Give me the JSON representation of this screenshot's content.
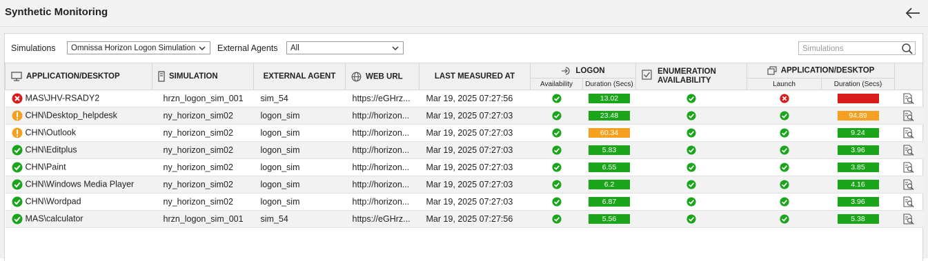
{
  "header": {
    "title": "Synthetic Monitoring",
    "back_icon": "back-arrow-icon"
  },
  "filters": {
    "simulations_label": "Simulations",
    "simulations_value": "Omnissa Horizon Logon Simulation",
    "agents_label": "External Agents",
    "agents_value": "All",
    "search_placeholder": "Simulations"
  },
  "table": {
    "headers": {
      "app": "APPLICATION/DESKTOP",
      "simulation": "SIMULATION",
      "agent": "EXTERNAL AGENT",
      "url": "WEB URL",
      "measured": "LAST MEASURED AT",
      "logon": "LOGON",
      "logon_avail": "Availability",
      "logon_dur": "Duration (Secs)",
      "enum_line1": "ENUMERATION",
      "enum_line2": "AVAILABILITY",
      "appdesk": "APPLICATION/DESKTOP",
      "launch": "Launch",
      "app_dur": "Duration (Secs)"
    },
    "colors": {
      "ok": "#1aa51a",
      "warn": "#f5a020",
      "error": "#d81c1c"
    },
    "rows": [
      {
        "status": "error",
        "app": "MAS\\JHV-RSADY2",
        "simulation": "hrzn_logon_sim_001",
        "agent": "sim_54",
        "url": "https://eGHrz...",
        "measured": "Mar 19, 2025 07:27:56",
        "logon_avail": "ok",
        "logon_dur": "13.02",
        "logon_color": "green",
        "enum_avail": "ok",
        "launch": "error",
        "app_dur": "",
        "app_color": "red"
      },
      {
        "status": "warn",
        "app": "CHN\\Desktop_helpdesk",
        "simulation": "ny_horizon_sim02",
        "agent": "logon_sim",
        "url": "http://horizon...",
        "measured": "Mar 19, 2025 07:27:03",
        "logon_avail": "ok",
        "logon_dur": "23.48",
        "logon_color": "green",
        "enum_avail": "ok",
        "launch": "ok",
        "app_dur": "94.89",
        "app_color": "orange"
      },
      {
        "status": "warn",
        "app": "CHN\\Outlook",
        "simulation": "ny_horizon_sim02",
        "agent": "logon_sim",
        "url": "http://horizon...",
        "measured": "Mar 19, 2025 07:27:03",
        "logon_avail": "ok",
        "logon_dur": "60.34",
        "logon_color": "orange",
        "enum_avail": "ok",
        "launch": "ok",
        "app_dur": "9.24",
        "app_color": "green"
      },
      {
        "status": "ok",
        "app": "CHN\\Editplus",
        "simulation": "ny_horizon_sim02",
        "agent": "logon_sim",
        "url": "http://horizon...",
        "measured": "Mar 19, 2025 07:27:03",
        "logon_avail": "ok",
        "logon_dur": "5.83",
        "logon_color": "green",
        "enum_avail": "ok",
        "launch": "ok",
        "app_dur": "3.96",
        "app_color": "green"
      },
      {
        "status": "ok",
        "app": "CHN\\Paint",
        "simulation": "ny_horizon_sim02",
        "agent": "logon_sim",
        "url": "http://horizon...",
        "measured": "Mar 19, 2025 07:27:03",
        "logon_avail": "ok",
        "logon_dur": "6.55",
        "logon_color": "green",
        "enum_avail": "ok",
        "launch": "ok",
        "app_dur": "3.85",
        "app_color": "green"
      },
      {
        "status": "ok",
        "app": "CHN\\Windows Media Player",
        "simulation": "ny_horizon_sim02",
        "agent": "logon_sim",
        "url": "http://horizon...",
        "measured": "Mar 19, 2025 07:27:03",
        "logon_avail": "ok",
        "logon_dur": "6.2",
        "logon_color": "green",
        "enum_avail": "ok",
        "launch": "ok",
        "app_dur": "4.16",
        "app_color": "green"
      },
      {
        "status": "ok",
        "app": "CHN\\Wordpad",
        "simulation": "ny_horizon_sim02",
        "agent": "logon_sim",
        "url": "http://horizon...",
        "measured": "Mar 19, 2025 07:27:03",
        "logon_avail": "ok",
        "logon_dur": "6.87",
        "logon_color": "green",
        "enum_avail": "ok",
        "launch": "ok",
        "app_dur": "3.96",
        "app_color": "green"
      },
      {
        "status": "ok",
        "app": "MAS\\calculator",
        "simulation": "hrzn_logon_sim_001",
        "agent": "sim_54",
        "url": "https://eGHrz...",
        "measured": "Mar 19, 2025 07:27:56",
        "logon_avail": "ok",
        "logon_dur": "5.56",
        "logon_color": "green",
        "enum_avail": "ok",
        "launch": "ok",
        "app_dur": "5.38",
        "app_color": "green"
      }
    ]
  }
}
